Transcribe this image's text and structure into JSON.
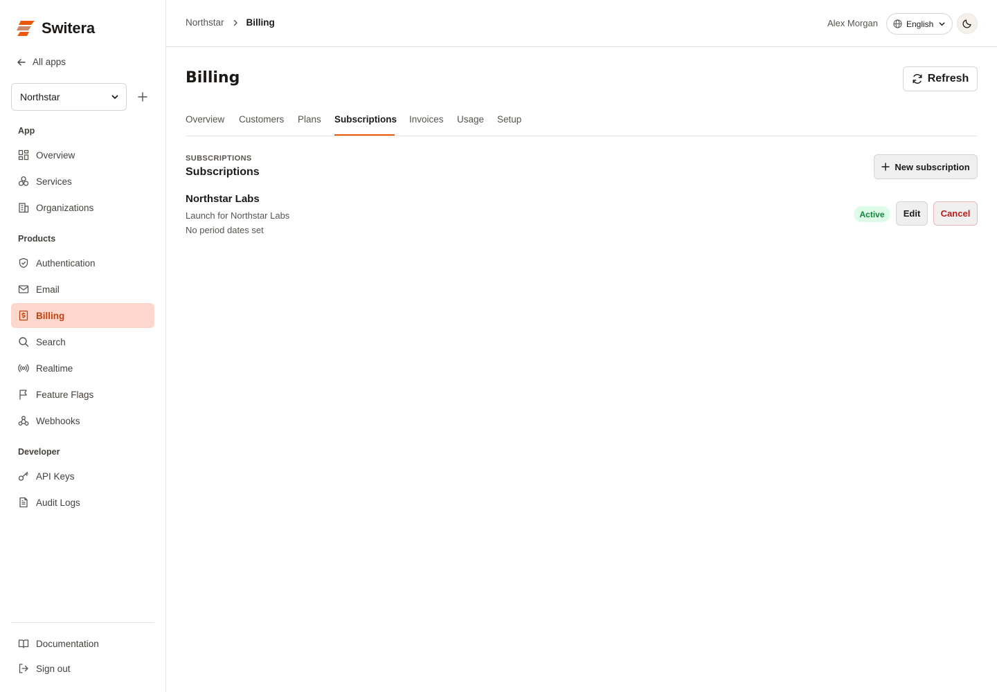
{
  "brand": {
    "name": "Switera",
    "accent": "#ea580c"
  },
  "sidebar": {
    "all_apps": "All apps",
    "app_select": {
      "value": "Northstar"
    },
    "sections": {
      "app": "App",
      "products": "Products",
      "developer": "Developer"
    },
    "app_items": [
      {
        "label": "Overview",
        "icon": "dashboard-grid-icon"
      },
      {
        "label": "Services",
        "icon": "cubes-icon"
      },
      {
        "label": "Organizations",
        "icon": "building-icon"
      }
    ],
    "product_items": [
      {
        "label": "Authentication",
        "icon": "shield-check-icon"
      },
      {
        "label": "Email",
        "icon": "mail-icon"
      },
      {
        "label": "Billing",
        "icon": "receipt-dollar-icon",
        "active": true
      },
      {
        "label": "Search",
        "icon": "search-icon"
      },
      {
        "label": "Realtime",
        "icon": "broadcast-icon"
      },
      {
        "label": "Feature Flags",
        "icon": "flag-icon"
      },
      {
        "label": "Webhooks",
        "icon": "webhook-icon"
      }
    ],
    "developer_items": [
      {
        "label": "API Keys",
        "icon": "key-icon"
      },
      {
        "label": "Audit Logs",
        "icon": "file-text-icon"
      }
    ],
    "footer_items": [
      {
        "label": "Documentation",
        "icon": "book-icon"
      },
      {
        "label": "Sign out",
        "icon": "log-out-icon"
      }
    ]
  },
  "header": {
    "breadcrumb": [
      "Northstar",
      "Billing"
    ],
    "user_name": "Alex Morgan",
    "language": "English"
  },
  "page": {
    "title": "Billing",
    "refresh_label": "Refresh",
    "tabs": [
      "Overview",
      "Customers",
      "Plans",
      "Subscriptions",
      "Invoices",
      "Usage",
      "Setup"
    ],
    "active_tab": "Subscriptions"
  },
  "subscriptions": {
    "eyebrow": "SUBSCRIPTIONS",
    "title": "Subscriptions",
    "new_label": "New subscription",
    "items": [
      {
        "name": "Northstar Labs",
        "description": "Launch for Northstar Labs",
        "period": "No period dates set",
        "status": "Active",
        "status_color": "#15803d",
        "edit_label": "Edit",
        "cancel_label": "Cancel"
      }
    ]
  }
}
